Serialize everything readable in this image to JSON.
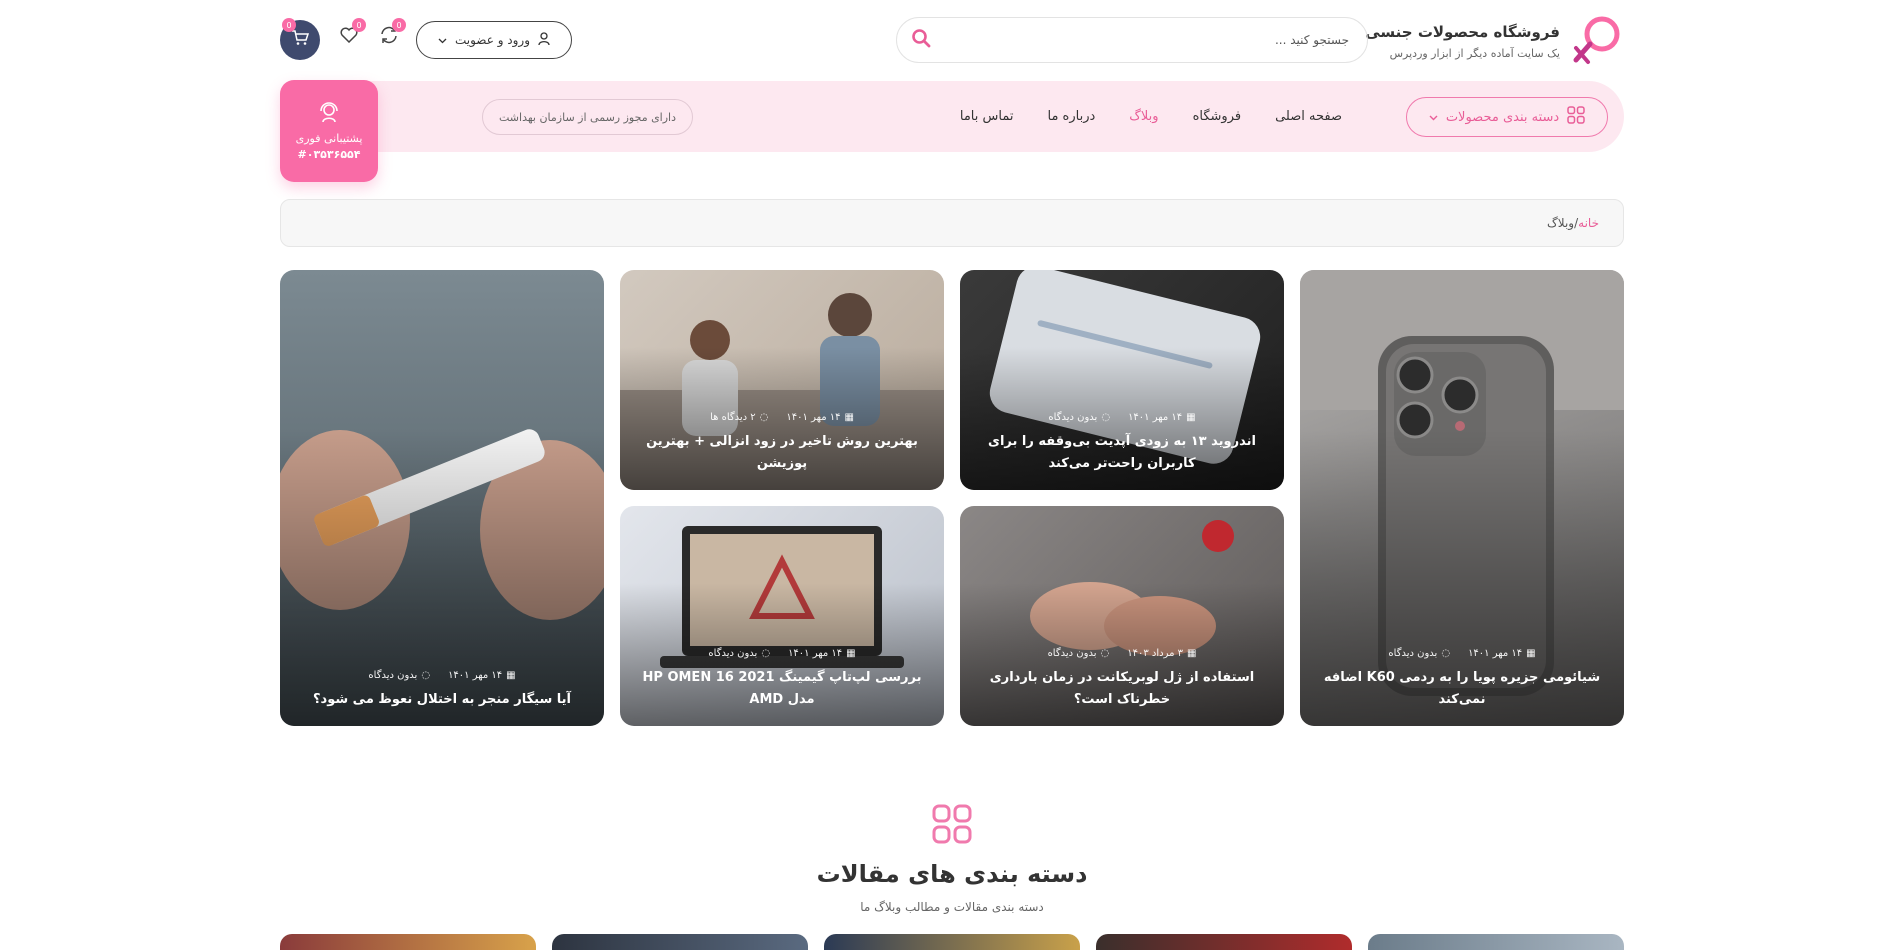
{
  "header": {
    "logo_title": "فروشگاه محصولات جنسی",
    "logo_subtitle": "یک سایت آماده دیگر از ابزار وردپرس",
    "search_placeholder": "جستجو کنید ...",
    "login_label": "ورود و عضویت",
    "compare_count": "0",
    "wishlist_count": "0",
    "cart_count": "0"
  },
  "nav": {
    "categories_label": "دسته بندی محصولات",
    "items": [
      {
        "label": "صفحه اصلی",
        "active": false
      },
      {
        "label": "فروشگاه",
        "active": false
      },
      {
        "label": "وبلاگ",
        "active": true
      },
      {
        "label": "درباره ما",
        "active": false
      },
      {
        "label": "تماس باما",
        "active": false
      }
    ],
    "license_text": "دارای مجوز رسمی از سازمان بهداشت",
    "support_label": "پشتیبانی فوری",
    "support_phone": "#۰۳۵۳۶۵۵۴"
  },
  "breadcrumb": {
    "home": "خانه",
    "separator": "/",
    "current": "وبلاگ"
  },
  "posts": [
    {
      "title": "شیائومی جزیره پویا را به ردمی K60 اضافه نمی‌کند",
      "date": "۱۴ مهر ۱۴۰۱",
      "comments": "بدون دیدگاه"
    },
    {
      "title": "اندروید ۱۳ به زودی آپدیت بی‌وقفه را برای کاربران راحت‌تر می‌کند",
      "date": "۱۴ مهر ۱۴۰۱",
      "comments": "بدون دیدگاه"
    },
    {
      "title": "بهترین روش تاخیر در زود انزالی + بهترین پوزیشن",
      "date": "۱۴ مهر ۱۴۰۱",
      "comments": "۲ دیدگاه ها"
    },
    {
      "title": "استفاده از ژل لوبریکانت در زمان بارداری خطرناک است؟",
      "date": "۳ مرداد ۱۴۰۳",
      "comments": "بدون دیدگاه"
    },
    {
      "title": "بررسی لپ‌تاپ گیمینگ HP OMEN 16 2021 مدل AMD",
      "date": "۱۴ مهر ۱۴۰۱",
      "comments": "بدون دیدگاه"
    },
    {
      "title": "آیا سیگار منجر به اختلال نعوظ می شود؟",
      "date": "۱۴ مهر ۱۴۰۱",
      "comments": "بدون دیدگاه"
    }
  ],
  "section": {
    "title": "دسته بندی های مقالات",
    "subtitle": "دسته بندی مقالات و مطالب وبلاگ ما"
  },
  "colors": {
    "accent": "#f96ba6",
    "nav_bg": "#fde8f0",
    "cart_bg": "#3f4a6e"
  }
}
